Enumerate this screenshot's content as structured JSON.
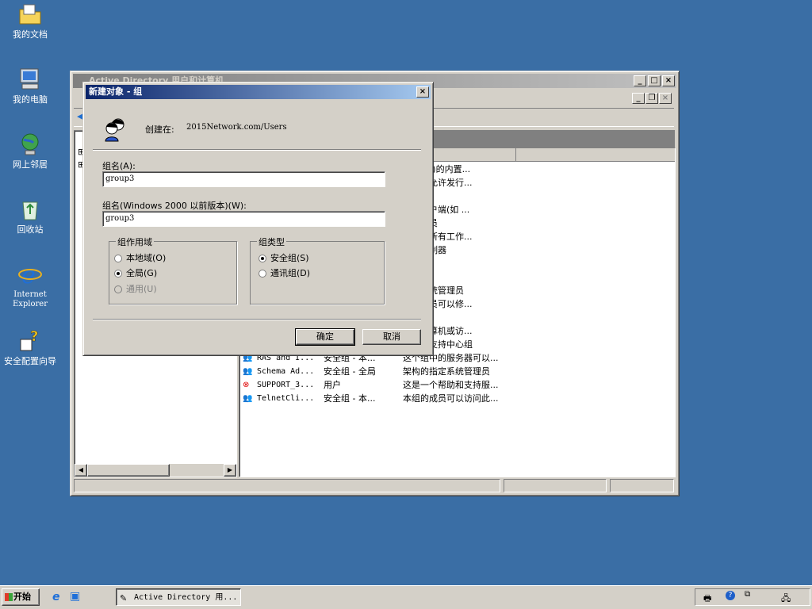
{
  "desktop": {
    "icons": [
      {
        "label": "我的文档",
        "icon": "folder-documents-icon"
      },
      {
        "label": "我的电脑",
        "icon": "my-computer-icon"
      },
      {
        "label": "网上邻居",
        "icon": "network-places-icon"
      },
      {
        "label": "回收站",
        "icon": "recycle-bin-icon"
      },
      {
        "label": "Internet Explorer",
        "icon": "internet-explorer-icon"
      },
      {
        "label": "安全配置向导",
        "icon": "security-wizard-icon"
      }
    ]
  },
  "main_window": {
    "title": "Active Directory 用户和计算机",
    "list_rows": [
      {
        "name": "",
        "type": "",
        "desc": "算机(域)的内置..."
      },
      {
        "name": "",
        "type": "",
        "desc": "成员被允许发行..."
      },
      {
        "name": "",
        "type": "",
        "desc": "理员组"
      },
      {
        "name": "",
        "type": "",
        "desc": "其他客户端(如 ..."
      },
      {
        "name": "",
        "type": "",
        "desc": "域管理员"
      },
      {
        "name": "",
        "type": "",
        "desc": "域中的所有工作..."
      },
      {
        "name": "",
        "type": "",
        "desc": "有域控制器"
      },
      {
        "name": "",
        "type": "",
        "desc": "有来宾"
      },
      {
        "name": "",
        "type": "",
        "desc": "用户"
      },
      {
        "name": "",
        "type": "",
        "desc": "指定系统管理员"
      },
      {
        "name": "",
        "type": "",
        "desc": "中的成员可以修..."
      },
      {
        "name": "",
        "type": "",
        "desc": ""
      },
      {
        "name": "",
        "type": "",
        "desc": "访问计算机或访..."
      },
      {
        "name": "HelpServi...",
        "type": "安全组 - 本...",
        "desc": "帮助和支持中心组"
      },
      {
        "name": "RAS and I...",
        "type": "安全组 - 本...",
        "desc": "这个组中的服务器可以..."
      },
      {
        "name": "Schema Ad...",
        "type": "安全组 - 全局",
        "desc": "架构的指定系统管理员"
      },
      {
        "name": "SUPPORT_3...",
        "type": "用户",
        "desc": "这是一个帮助和支持服..."
      },
      {
        "name": "TelnetCli...",
        "type": "安全组 - 本...",
        "desc": "本组的成员可以访问此..."
      }
    ]
  },
  "dialog": {
    "title": "新建对象 - 组",
    "created_in_label": "创建在:",
    "created_in_path": "2015Network.com/Users",
    "group_name_label": "组名(A):",
    "group_name_value": "group3",
    "group_name_pre2000_label": "组名(Windows 2000 以前版本)(W):",
    "group_name_pre2000_value": "group3",
    "scope_title": "组作用域",
    "scope_options": [
      {
        "label": "本地域(O)",
        "checked": false,
        "disabled": false
      },
      {
        "label": "全局(G)",
        "checked": true,
        "disabled": false
      },
      {
        "label": "通用(U)",
        "checked": false,
        "disabled": true
      }
    ],
    "type_title": "组类型",
    "type_options": [
      {
        "label": "安全组(S)",
        "checked": true
      },
      {
        "label": "通讯组(D)",
        "checked": false
      }
    ],
    "ok_label": "确定",
    "cancel_label": "取消"
  },
  "taskbar": {
    "start_label": "开始",
    "task_label": "Active Directory 用..."
  }
}
